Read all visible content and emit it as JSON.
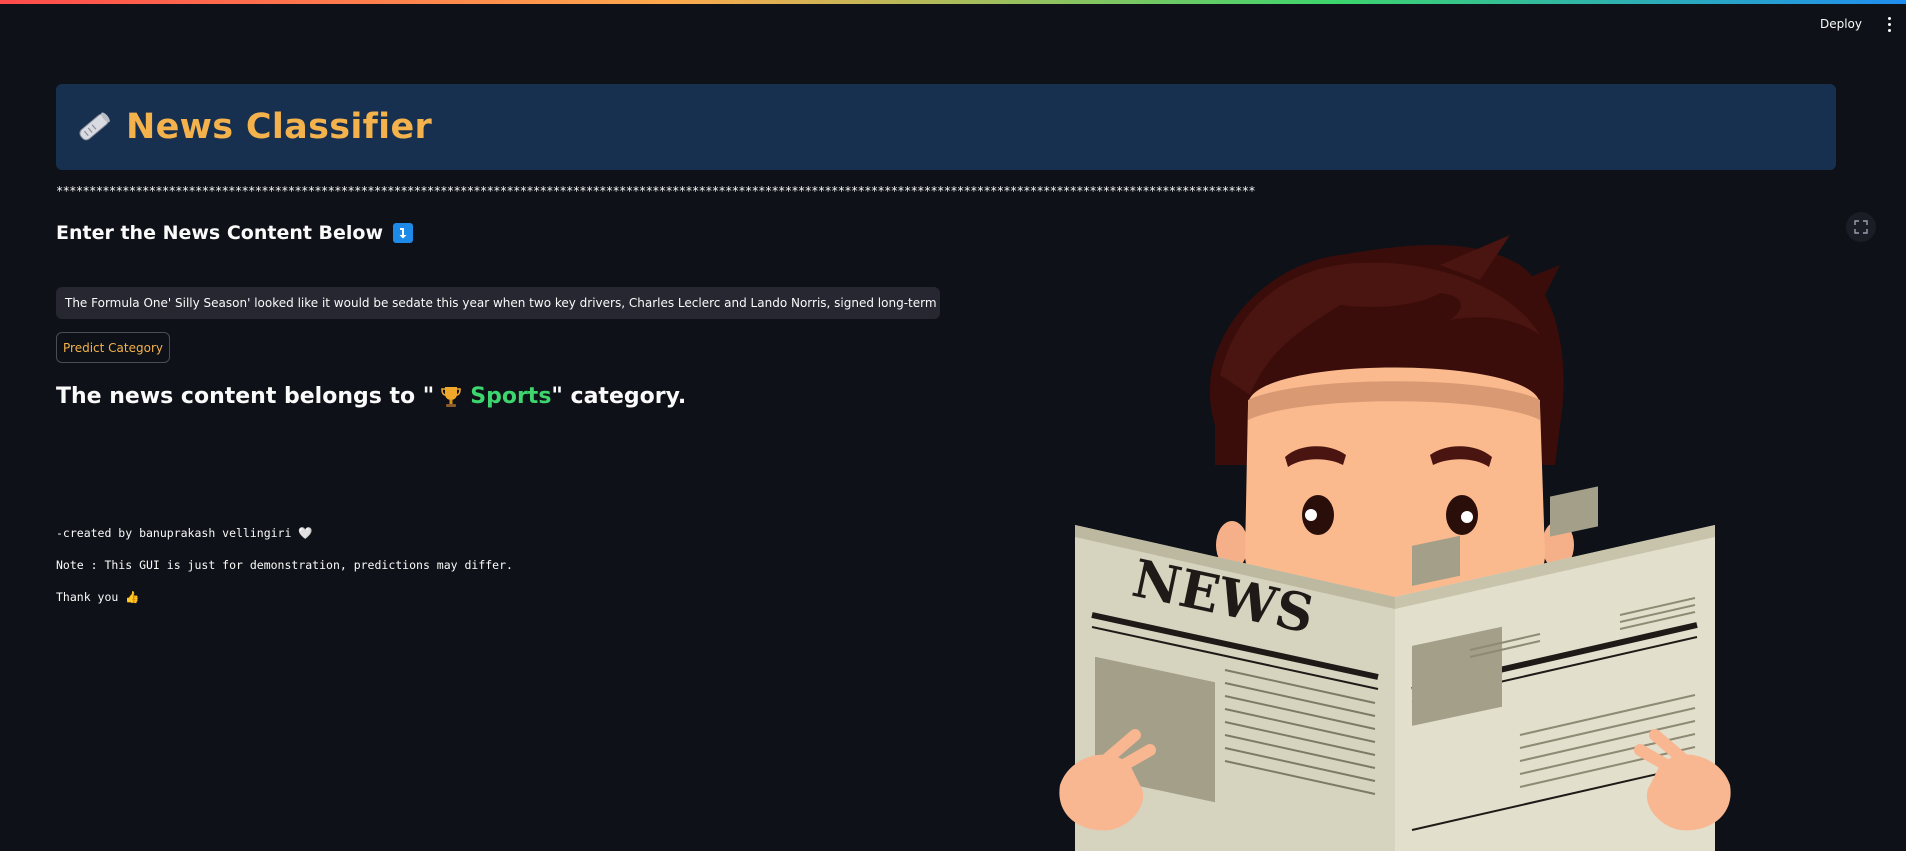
{
  "toolbar": {
    "deploy_label": "Deploy",
    "menu_icon": "kebab-menu-icon"
  },
  "header": {
    "icon": "rolled-newspaper-icon",
    "title": "News Classifier",
    "title_color": "#f4b24c",
    "banner_color": "#18304f"
  },
  "separator": "**********************************************************************************************************************************************************************************************",
  "input_section": {
    "heading": "Enter the News Content Below",
    "heading_icon": "arrow-down-right-icon",
    "value": "The Formula One' Silly Season' looked like it would be sedate this year when two key drivers, Charles Leclerc and Lando Norris, signed long-term deals with Fe"
  },
  "predict_button": {
    "label": "Predict Category"
  },
  "result": {
    "prefix": "The news content belongs to \"",
    "icon": "trophy-icon",
    "category": "Sports",
    "suffix": "\" category.",
    "category_color": "#3dd56d"
  },
  "footer": {
    "created_by": "-created by banuprakash vellingiri 🤍",
    "note": "Note : This GUI is just for demonstration, predictions may differ.",
    "thanks": "Thank you 👍"
  },
  "illustration": {
    "newspaper_title": "NEWS"
  },
  "colors": {
    "background": "#0e1117",
    "accent": "#f4b24c",
    "success": "#3dd56d"
  }
}
